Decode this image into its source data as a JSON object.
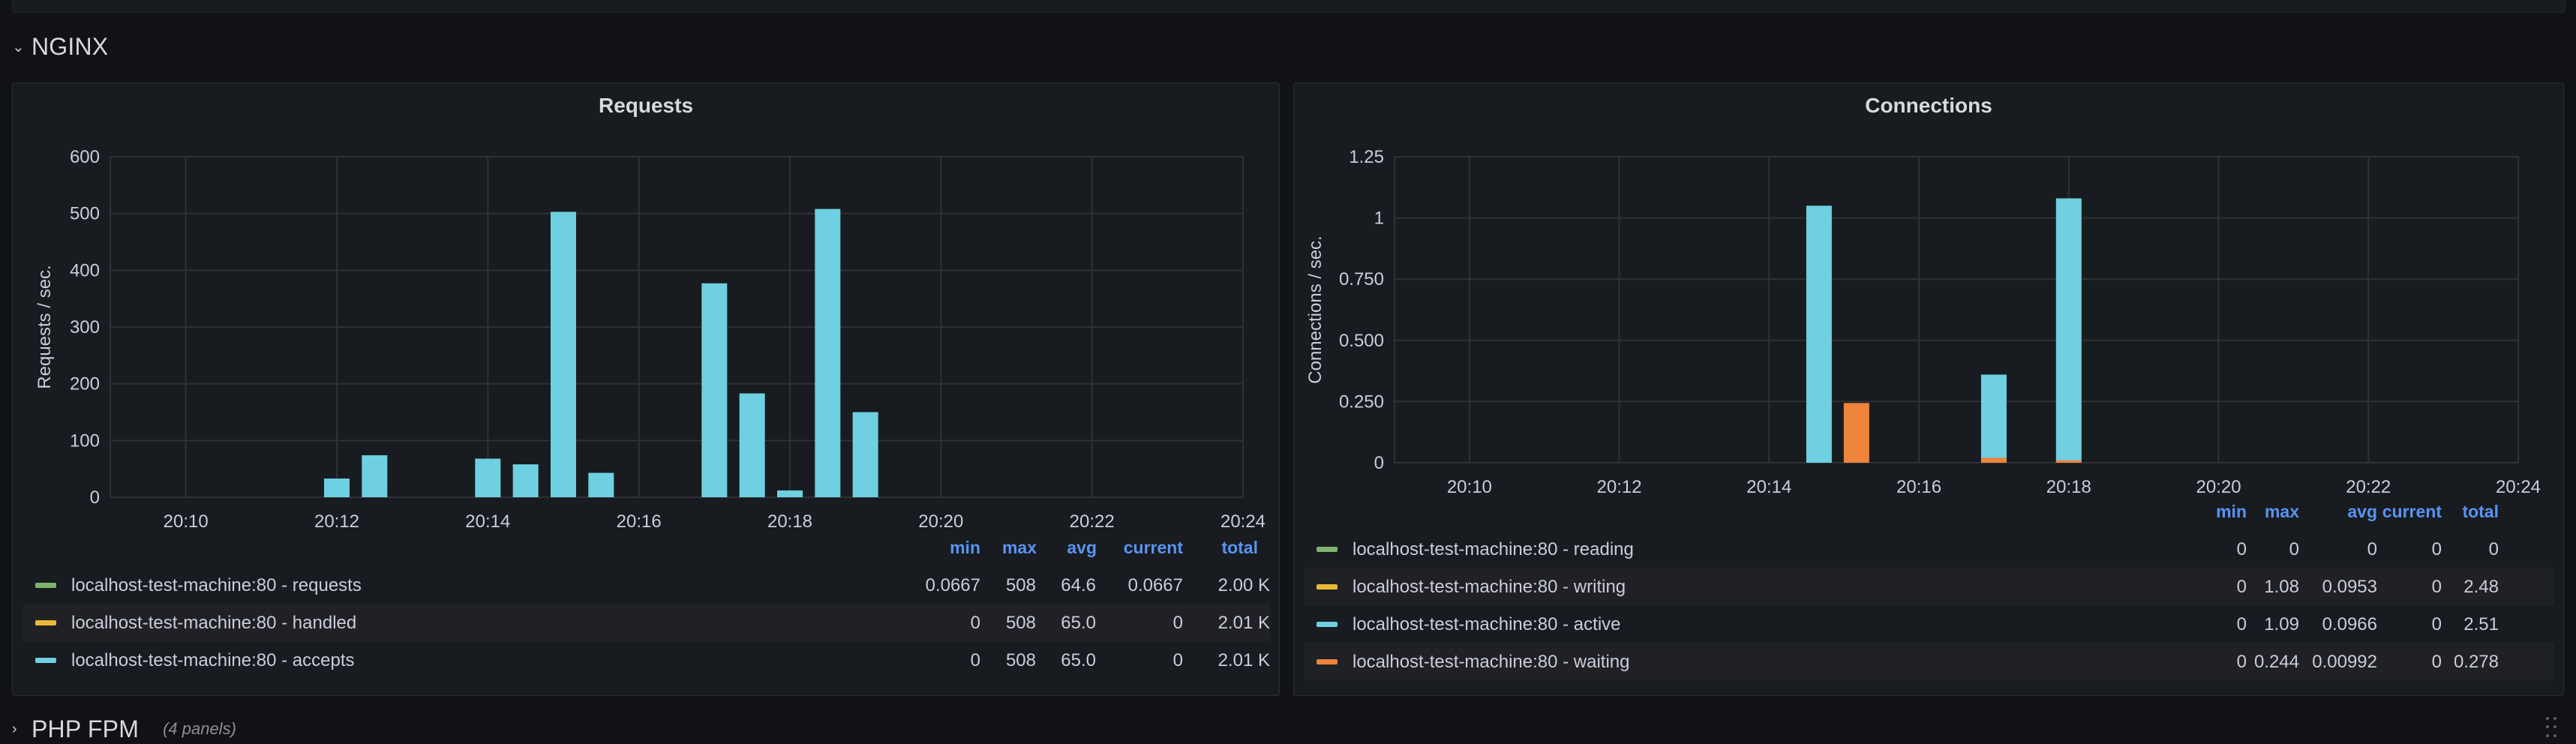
{
  "top_strip_text": "(4 panels)",
  "rows": [
    {
      "title": "NGINX",
      "expanded": true
    },
    {
      "title": "PHP FPM",
      "panels_count": "(4 panels)",
      "expanded": false
    }
  ],
  "colors": {
    "green": "#7eb26d",
    "yellow": "#eab839",
    "cyan": "#6ed0e0",
    "orange": "#ef843c",
    "grid": "#2f3136",
    "bg": "#181b1f"
  },
  "legend_headers": [
    "min",
    "max",
    "avg",
    "current",
    "total"
  ],
  "panels": [
    {
      "title": "Requests",
      "legend": [
        {
          "name": "localhost-test-machine:80 - requests",
          "color": "#7eb26d",
          "min": "0.0667",
          "max": "508",
          "avg": "64.6",
          "current": "0.0667",
          "total": "2.00 K"
        },
        {
          "name": "localhost-test-machine:80 - handled",
          "color": "#eab839",
          "min": "0",
          "max": "508",
          "avg": "65.0",
          "current": "0",
          "total": "2.01 K"
        },
        {
          "name": "localhost-test-machine:80 - accepts",
          "color": "#6ed0e0",
          "min": "0",
          "max": "508",
          "avg": "65.0",
          "current": "0",
          "total": "2.01 K"
        }
      ]
    },
    {
      "title": "Connections",
      "legend": [
        {
          "name": "localhost-test-machine:80 - reading",
          "color": "#7eb26d",
          "min": "0",
          "max": "0",
          "avg": "0",
          "current": "0",
          "total": "0"
        },
        {
          "name": "localhost-test-machine:80 - writing",
          "color": "#eab839",
          "min": "0",
          "max": "1.08",
          "avg": "0.0953",
          "current": "0",
          "total": "2.48"
        },
        {
          "name": "localhost-test-machine:80 - active",
          "color": "#6ed0e0",
          "min": "0",
          "max": "1.09",
          "avg": "0.0966",
          "current": "0",
          "total": "2.51"
        },
        {
          "name": "localhost-test-machine:80 - waiting",
          "color": "#ef843c",
          "min": "0",
          "max": "0.244",
          "avg": "0.00992",
          "current": "0",
          "total": "0.278"
        }
      ]
    }
  ],
  "chart_data": [
    {
      "type": "bar",
      "title": "Requests",
      "ylabel": "Requests / sec.",
      "xlabel": "",
      "x_ticks": [
        "20:10",
        "20:12",
        "20:14",
        "20:16",
        "20:18",
        "20:20",
        "20:22",
        "20:24"
      ],
      "y_ticks": [
        "0",
        "100",
        "200",
        "300",
        "400",
        "500",
        "600"
      ],
      "ylim": [
        0,
        600
      ],
      "x_range_minutes": [
        "20:09",
        "20:24"
      ],
      "grid": true,
      "series": [
        {
          "name": "localhost-test-machine:80 - accepts",
          "color": "#6ed0e0",
          "x": [
            "20:12",
            "20:12:30",
            "20:14",
            "20:14:30",
            "20:15",
            "20:15:30",
            "20:17",
            "20:17:30",
            "20:18",
            "20:18:30",
            "20:19"
          ],
          "values": [
            33,
            74,
            68,
            58,
            503,
            43,
            377,
            183,
            12,
            508,
            150
          ]
        }
      ]
    },
    {
      "type": "bar",
      "title": "Connections",
      "ylabel": "Connections / sec.",
      "xlabel": "",
      "x_ticks": [
        "20:10",
        "20:12",
        "20:14",
        "20:16",
        "20:18",
        "20:20",
        "20:22",
        "20:24"
      ],
      "y_ticks": [
        "0",
        "0.250",
        "0.500",
        "0.750",
        "1",
        "1.25"
      ],
      "ylim": [
        0,
        1.25
      ],
      "grid": true,
      "series": [
        {
          "name": "localhost-test-machine:80 - active",
          "color": "#6ed0e0",
          "x": [
            "20:14:40",
            "20:17",
            "20:18"
          ],
          "values": [
            1.05,
            0.36,
            1.08
          ]
        },
        {
          "name": "localhost-test-machine:80 - waiting",
          "color": "#ef843c",
          "x": [
            "20:15:10",
            "20:17",
            "20:18"
          ],
          "values": [
            0.244,
            0.02,
            0.01
          ]
        }
      ]
    }
  ]
}
